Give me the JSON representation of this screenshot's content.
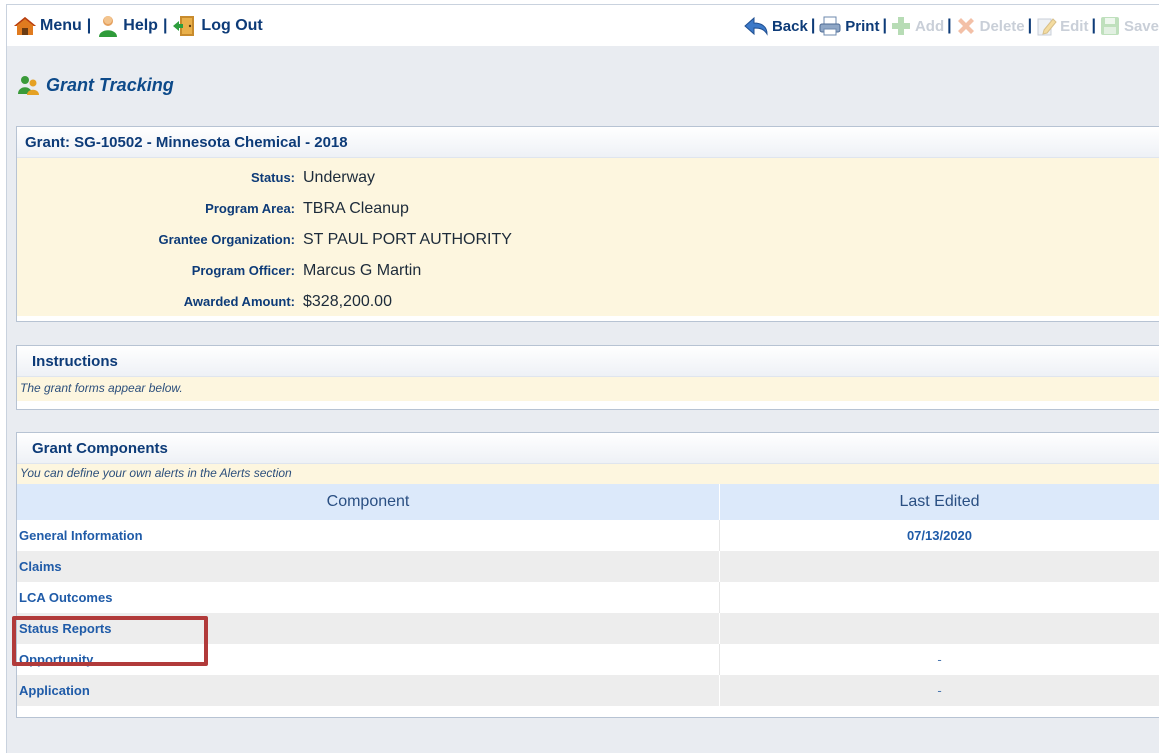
{
  "toolbar": {
    "menu_label": "Menu",
    "help_label": "Help",
    "logout_label": "Log Out",
    "back_label": "Back",
    "print_label": "Print",
    "add_label": "Add",
    "delete_label": "Delete",
    "edit_label": "Edit",
    "save_label": "Save",
    "separator": "|"
  },
  "page": {
    "title": "Grant Tracking"
  },
  "grant": {
    "header": "Grant: SG-10502 - Minnesota Chemical - 2018",
    "fields": [
      {
        "label": "Status:",
        "value": "Underway"
      },
      {
        "label": "Program Area:",
        "value": "TBRA Cleanup"
      },
      {
        "label": "Grantee Organization:",
        "value": "ST PAUL PORT AUTHORITY"
      },
      {
        "label": "Program Officer:",
        "value": "Marcus G Martin"
      },
      {
        "label": "Awarded Amount:",
        "value": "$328,200.00"
      }
    ]
  },
  "instructions": {
    "header": "Instructions",
    "note": "The grant forms appear below."
  },
  "components": {
    "header": "Grant Components",
    "note": "You can define your own alerts in the Alerts section",
    "columns": [
      "Component",
      "Last Edited"
    ],
    "rows": [
      {
        "name": "General Information",
        "last_edited": "07/13/2020"
      },
      {
        "name": "Claims",
        "last_edited": ""
      },
      {
        "name": "LCA Outcomes",
        "last_edited": ""
      },
      {
        "name": "Status Reports",
        "last_edited": ""
      },
      {
        "name": "Opportunity",
        "last_edited": "-"
      },
      {
        "name": "Application",
        "last_edited": "-"
      }
    ]
  },
  "colors": {
    "highlight_border": "#b13a3a",
    "link_blue": "#1f5ba8",
    "detail_background": "#fdf6df"
  }
}
